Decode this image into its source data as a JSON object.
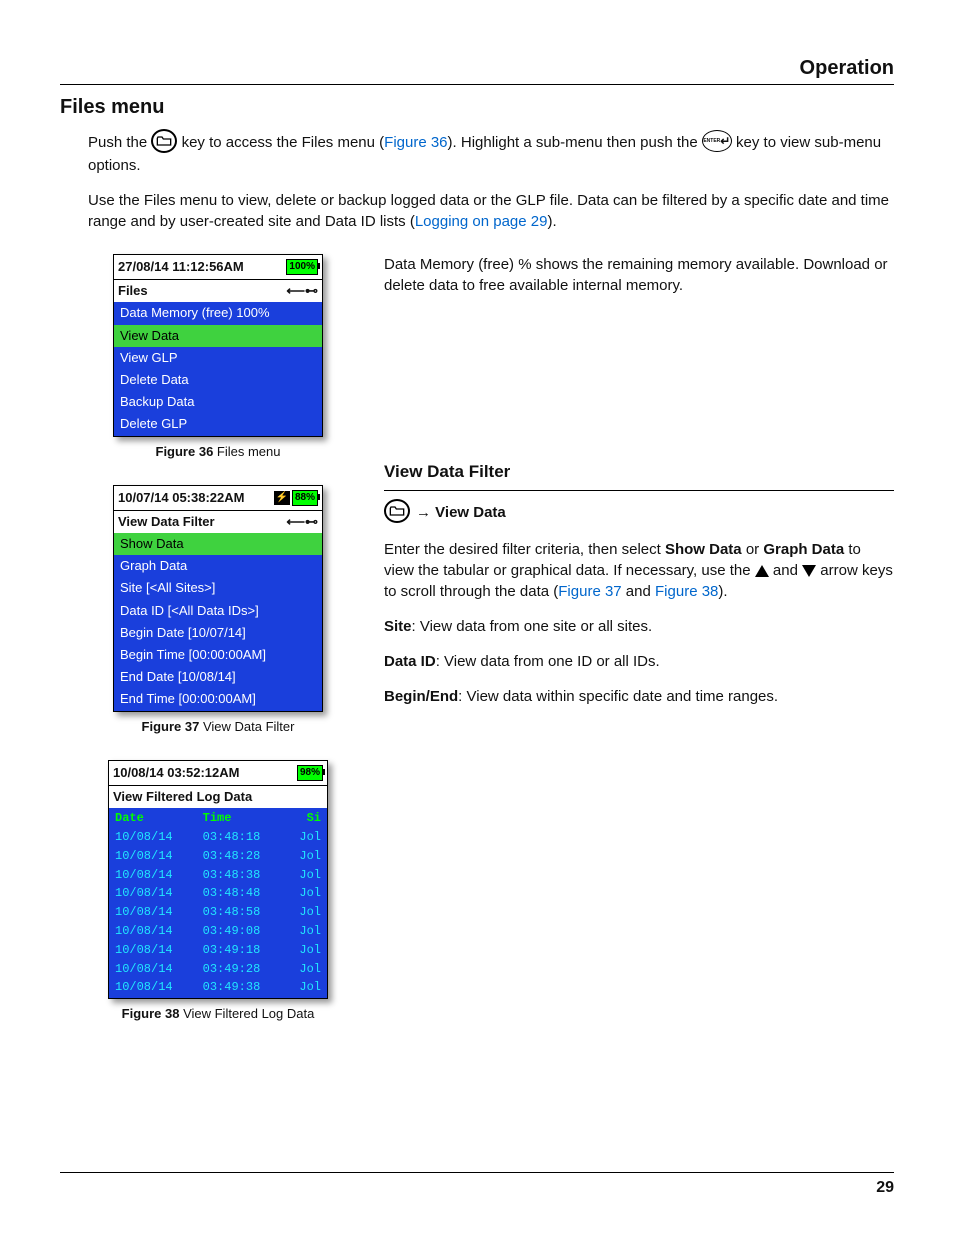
{
  "header": {
    "section": "Operation"
  },
  "h1": "Files menu",
  "intro": {
    "p1a": "Push the ",
    "p1b": " key to access the Files menu (",
    "link1": "Figure 36",
    "p1c": "). Highlight a sub-menu then push the ",
    "p1d": " key to view sub-menu options.",
    "p2a": "Use the Files menu to view, delete or backup logged data or the GLP file.  Data can be filtered by a specific date and time range and by user-created site and Data ID lists (",
    "link2": "Logging on page 29",
    "p2b": ")."
  },
  "fig36": {
    "datetime": "27/08/14  11:12:56AM",
    "batt": "100%",
    "title": "Files",
    "items": [
      "Data Memory (free) 100%",
      "View Data",
      "View GLP",
      "Delete Data",
      "Backup Data",
      "Delete GLP"
    ],
    "caption_label": "Figure 36",
    "caption_text": "  Files menu",
    "desc": "Data Memory (free) % shows the remaining memory available. Download or delete data to free available internal memory."
  },
  "vdf": {
    "heading": "View Data Filter",
    "nav": "→ View Data",
    "p1a": "Enter the desired filter criteria, then select ",
    "b1": "Show Data",
    "p1b": " or ",
    "b2": "Graph Data",
    "p1c": " to view the tabular or graphical data. If necessary, use the ",
    "p1d": " and ",
    "p1e": " arrow keys to scroll through the data (",
    "link37": "Figure 37",
    "p1f": " and ",
    "link38": "Figure 38",
    "p1g": ").",
    "site_b": "Site",
    "site_t": ": View data from one site or all sites.",
    "did_b": "Data ID",
    "did_t": ": View data from one ID or all IDs.",
    "be_b": "Begin/End",
    "be_t": ": View data within specific date and time ranges."
  },
  "fig37": {
    "datetime": "10/07/14  05:38:22AM",
    "batt": "88%",
    "title": "View Data Filter",
    "items": [
      "Show Data",
      "Graph Data",
      "Site [<All Sites>]",
      "Data ID [<All Data IDs>]",
      "Begin Date [10/07/14]",
      "Begin Time [00:00:00AM]",
      "End Date [10/08/14]",
      "End Time [00:00:00AM]"
    ],
    "caption_label": "Figure 37",
    "caption_text": "  View Data Filter"
  },
  "fig38": {
    "datetime": "10/08/14  03:52:12AM",
    "batt": "98%",
    "title": "View Filtered Log Data",
    "columns": [
      "Date",
      "Time",
      "Si"
    ],
    "rows": [
      [
        "10/08/14",
        "03:48:18",
        "Jol"
      ],
      [
        "10/08/14",
        "03:48:28",
        "Jol"
      ],
      [
        "10/08/14",
        "03:48:38",
        "Jol"
      ],
      [
        "10/08/14",
        "03:48:48",
        "Jol"
      ],
      [
        "10/08/14",
        "03:48:58",
        "Jol"
      ],
      [
        "10/08/14",
        "03:49:08",
        "Jol"
      ],
      [
        "10/08/14",
        "03:49:18",
        "Jol"
      ],
      [
        "10/08/14",
        "03:49:28",
        "Jol"
      ],
      [
        "10/08/14",
        "03:49:38",
        "Jol"
      ]
    ],
    "caption_label": "Figure 38",
    "caption_text": "  View Filtered Log Data"
  },
  "page": "29"
}
